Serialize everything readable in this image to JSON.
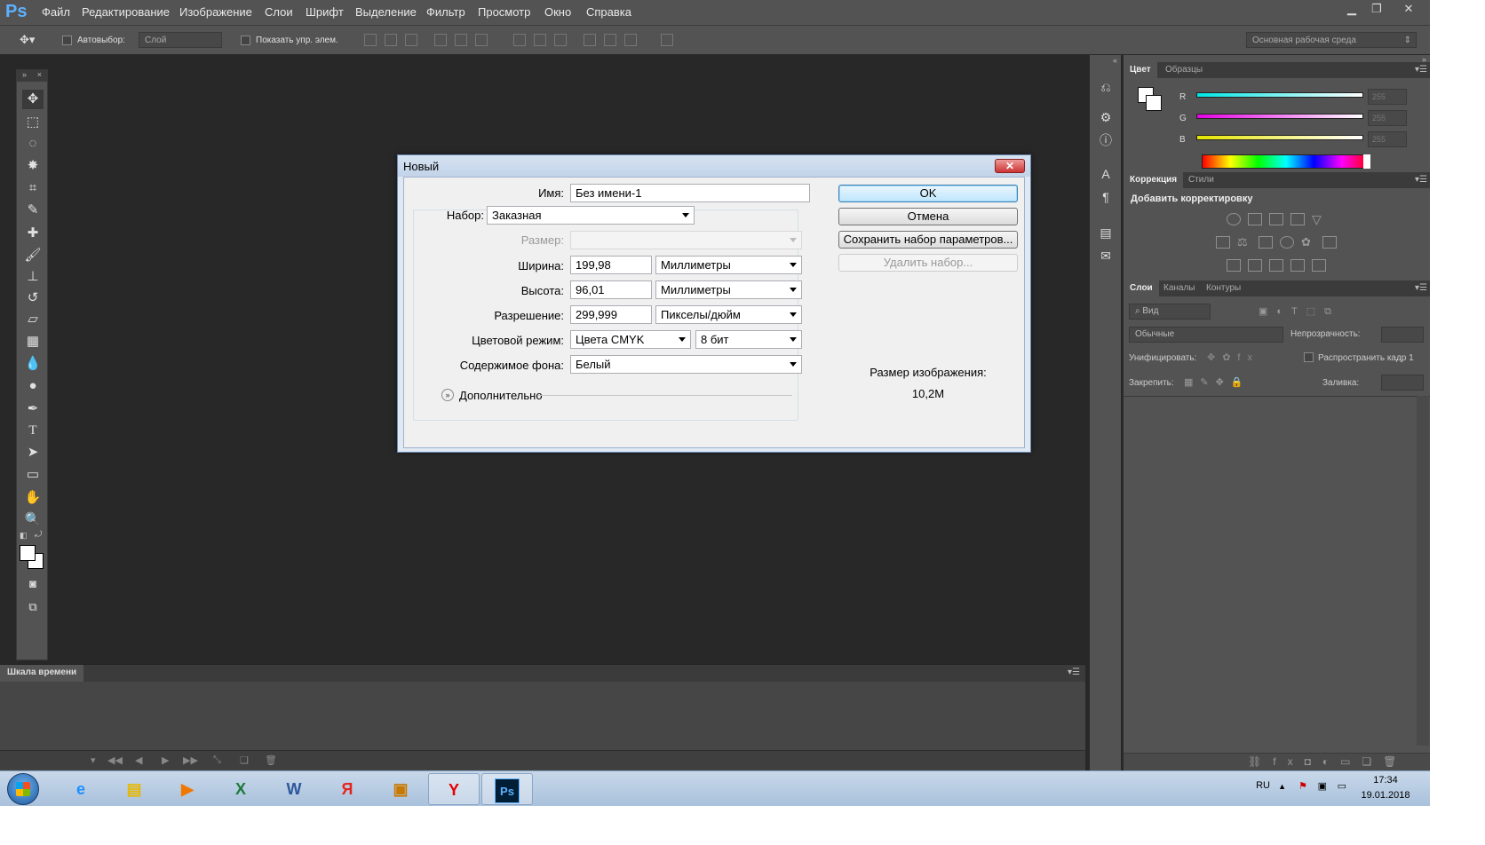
{
  "app": {
    "logo": "Ps",
    "menu": [
      "Файл",
      "Редактирование",
      "Изображение",
      "Слои",
      "Шрифт",
      "Выделение",
      "Фильтр",
      "Просмотр",
      "Окно",
      "Справка"
    ]
  },
  "options_bar": {
    "autoselect_label": "Автовыбор:",
    "autoselect_value": "Слой",
    "show_transform_label": "Показать упр. элем.",
    "workspace": "Основная рабочая среда"
  },
  "timeline": {
    "tab": "Шкала времени"
  },
  "color_panel": {
    "tabs": [
      "Цвет",
      "Образцы"
    ],
    "channels": [
      {
        "name": "R",
        "value": "255",
        "color": "#00e5e5"
      },
      {
        "name": "G",
        "value": "255",
        "color": "#e500e5"
      },
      {
        "name": "B",
        "value": "255",
        "color": "#e5e500"
      }
    ]
  },
  "adjustments_panel": {
    "tabs": [
      "Коррекция",
      "Стили"
    ],
    "title": "Добавить корректировку"
  },
  "layers_panel": {
    "tabs": [
      "Слои",
      "Каналы",
      "Контуры"
    ],
    "filter": "Вид",
    "blend_mode": "Обычные",
    "opacity_label": "Непрозрачность:",
    "unify_label": "Унифицировать:",
    "propagate_label": "Распространить кадр 1",
    "lock_label": "Закрепить:",
    "fill_label": "Заливка:"
  },
  "dialog": {
    "title": "Новый",
    "name_label": "Имя:",
    "name_value": "Без имени-1",
    "preset_label": "Набор:",
    "preset_value": "Заказная",
    "size_label": "Размер:",
    "width_label": "Ширина:",
    "width_value": "199,98",
    "width_unit": "Миллиметры",
    "height_label": "Высота:",
    "height_value": "96,01",
    "height_unit": "Миллиметры",
    "resolution_label": "Разрешение:",
    "resolution_value": "299,999",
    "resolution_unit": "Пикселы/дюйм",
    "color_mode_label": "Цветовой режим:",
    "color_mode_value": "Цвета CMYK",
    "bit_depth": "8 бит",
    "background_label": "Содержимое фона:",
    "background_value": "Белый",
    "advanced_label": "Дополнительно",
    "ok_label": "OK",
    "cancel_label": "Отмена",
    "save_preset_label": "Сохранить набор параметров...",
    "delete_preset_label": "Удалить набор...",
    "image_size_label": "Размер изображения:",
    "image_size_value": "10,2M"
  },
  "taskbar": {
    "lang": "RU",
    "time": "17:34",
    "date": "19.01.2018"
  }
}
